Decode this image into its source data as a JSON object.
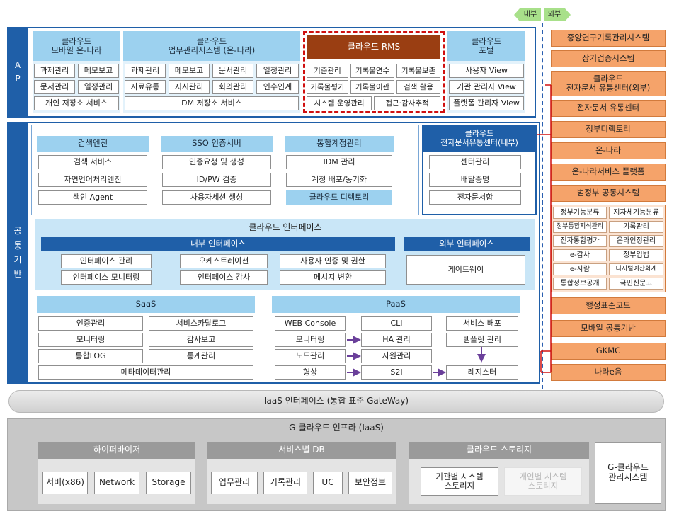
{
  "legend": {
    "inner": "내부",
    "outer": "외부"
  },
  "ap": {
    "side_label": "A\nP",
    "mobile": {
      "title": "클라우드\n모바일 온-나라",
      "items": [
        "과제관리",
        "메모보고",
        "문서관리",
        "일정관리",
        "개인 저장소 서비스"
      ]
    },
    "biz": {
      "title": "클라우드\n업무관리시스템 (온-나라)",
      "items": [
        "과제관리",
        "메모보고",
        "문서관리",
        "일정관리",
        "자료유통",
        "지시관리",
        "회의관리",
        "인수인계",
        "DM 저장소 서비스"
      ]
    },
    "rms": {
      "title": "클라우드 RMS",
      "items": [
        "기준관리",
        "기록물연수",
        "기록물보존",
        "기록물평가",
        "기록물이관",
        "검색 활용",
        "시스템 운영관리",
        "접근·감사추적"
      ]
    },
    "portal": {
      "title": "클라우드\n포털",
      "items": [
        "사용자 View",
        "기관 관리자 View",
        "플랫폼 관리자 View"
      ]
    }
  },
  "common": {
    "side_label": "공\n통\n기\n반",
    "search": {
      "title": "검색엔진",
      "items": [
        "검색 서비스",
        "자연언어처리엔진",
        "색인 Agent"
      ]
    },
    "sso": {
      "title": "SSO 인증서버",
      "items": [
        "인증요청 및 생성",
        "ID/PW 검증",
        "사용자세션 생성"
      ]
    },
    "account": {
      "title": "통합계정관리",
      "items": [
        "IDM 관리",
        "계정 배포/동기화",
        "클라우드 디렉토리"
      ]
    },
    "edoc_inner": {
      "title": "클라우드\n전자문서유통센터(내부)",
      "items": [
        "센터관리",
        "배달증명",
        "전자문서함"
      ]
    },
    "interface": {
      "title": "클라우드 인터페이스",
      "inner_title": "내부 인터페이스",
      "inner_items": [
        "인터페이스 관리",
        "오케스트레이션",
        "사용자 인증 및 권한",
        "인터페이스 모니터링",
        "인터페이스 감사",
        "메시지 변환"
      ],
      "outer_title": "외부 인터페이스",
      "outer_items": [
        "게이트웨이"
      ]
    },
    "saas": {
      "title": "SaaS",
      "items": [
        "인증관리",
        "서비스카달로그",
        "모니터링",
        "감사보고",
        "통합LOG",
        "통계관리",
        "메타데이터관리"
      ]
    },
    "paas": {
      "title": "PaaS",
      "items": [
        "WEB Console",
        "CLI",
        "서비스 배포",
        "모니터링",
        "HA 관리",
        "템플릿 관리",
        "노드관리",
        "자원관리",
        "형상",
        "S2I",
        "레지스터"
      ]
    }
  },
  "iaas_interface": "IaaS 인터페이스 (통합 표준 GateWay)",
  "infra": {
    "title": "G-클라우드 인프라 (IaaS)",
    "hypervisor": {
      "title": "하이퍼바이저",
      "items": [
        "서버(x86)",
        "Network",
        "Storage"
      ]
    },
    "db": {
      "title": "서비스별 DB",
      "items": [
        "업무관리",
        "기록관리",
        "UC",
        "보안정보"
      ]
    },
    "storage": {
      "title": "클라우드 스토리지",
      "items": [
        "기관별 시스템\n스토리지",
        "개인별 시스템\n스토리지"
      ]
    },
    "mgmt": "G-클라우드\n관리시스템"
  },
  "external": {
    "items_top": [
      "중앙연구기록관리시스템",
      "장기검증시스템",
      "클라우드\n전자문서 유통센터(외부)",
      "전자문서 유통센터",
      "정부디렉토리",
      "온-나라",
      "온-나라서비스 플랫폼",
      "범정부 공동시스템"
    ],
    "sub_items": [
      "정부기능분류",
      "지자체기능분류",
      "정부통합지식관리",
      "기록관리",
      "전자통합평가",
      "온라인정관리",
      "e-감사",
      "정부입법",
      "e-사람",
      "디지털예산회계",
      "통합정보공개",
      "국민신문고"
    ],
    "items_bottom": [
      "행정표준코드",
      "모바일 공통기반",
      "GKMC",
      "나라e음"
    ]
  },
  "colors": {
    "sidebar": "#1f5fa8",
    "light_blue": "#9cd1ef",
    "orange": "#f5a36a",
    "rms_brown": "#9a3e12",
    "rms_border": "#d01010"
  }
}
